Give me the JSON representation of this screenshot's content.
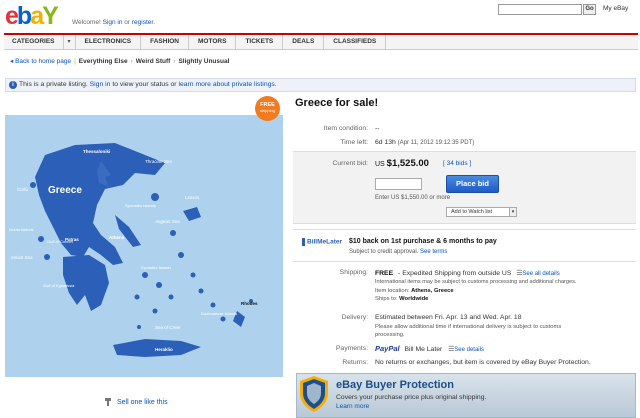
{
  "header": {
    "logo_letters": [
      "e",
      "b",
      "a",
      "Y"
    ],
    "logo_colors": [
      "#e53238",
      "#0064d2",
      "#f5af02",
      "#86b817"
    ],
    "welcome_prefix": "Welcome! ",
    "sign_in": "Sign in",
    "or": " or ",
    "register": "register",
    "register_suffix": ".",
    "search_value": "",
    "go_label": "Go",
    "my_ebay": "My eBay"
  },
  "nav": {
    "items": [
      "CATEGORIES",
      "ELECTRONICS",
      "FASHION",
      "MOTORS",
      "TICKETS",
      "DEALS",
      "CLASSIFIEDS"
    ],
    "caret": "▾"
  },
  "breadcrumb": {
    "back": "Back to home page",
    "path": [
      "Everything Else",
      "Weird Stuff",
      "Slightly Unusual"
    ],
    "sep": "|",
    "chev": "›"
  },
  "notice": {
    "icon": "i",
    "text_pre": "This is a private listing. ",
    "sign_in": "Sign in",
    "text_mid": " to view your status or ",
    "learn_more": "learn more about private listings",
    "text_post": "."
  },
  "image": {
    "badge_line1": "FREE",
    "badge_line2": "shipping",
    "map_labels": {
      "greece": "Greece",
      "thessaloniki": "Thessaloniki",
      "thracian": "Thracian Sea",
      "aegean": "Aegean Sea",
      "ionian": "Ionian Sea",
      "crete": "Sea of Crete",
      "athens": "Athens",
      "patras": "Patras",
      "corfu": "Corfu",
      "lesvos": "Lesvos",
      "rhodes": "Rhodes",
      "heraklio": "Heraklio",
      "sporades": "Sporades Islands",
      "cyclades": "Cyclades Islands",
      "dodecanese": "Dodecanese Islands",
      "ionian_islands": "Ionian Islands",
      "corinth": "Gulf of Corinth",
      "kyparissia": "Gulf of Kyparissia"
    },
    "sell_one": "Sell one like this"
  },
  "listing": {
    "title": "Greece for sale!",
    "condition_label": "Item condition:",
    "condition_value": "--",
    "time_label": "Time left:",
    "time_value": "6d 13h",
    "time_detail": "(Apr 11, 2012 19:12:35 PDT)",
    "bid_label": "Current bid:",
    "currency": "US ",
    "price": "$1,525.00",
    "bids_open": "[ ",
    "bids": "34 bids",
    "bids_close": " ]",
    "bid_input_value": "",
    "place_bid": "Place bid",
    "enter_min": "Enter US $1,550.00 or more",
    "watch": "Add to Watch list",
    "watch_caret": "▾"
  },
  "billmelater": {
    "logo": "BillMeLater",
    "offer": "$10 back on 1st purchase & 6 months to pay",
    "sub": "Subject to credit approval. ",
    "see_terms": "See terms"
  },
  "shipping": {
    "label": "Shipping:",
    "free": "FREE",
    "method": "Expedited Shipping from outside US",
    "see_all": "See all details",
    "note": "International items may be subject to customs processing and additional charges.",
    "location_label": "Item location: ",
    "location": "Athens, Greece",
    "ships_label": "Ships to: ",
    "ships_to": "Worldwide"
  },
  "delivery": {
    "label": "Delivery:",
    "estimate": "Estimated between Fri. Apr. 13 and Wed. Apr. 18",
    "note1": "Please allow additional time if international delivery is subject to customs",
    "note2": "processing."
  },
  "payments": {
    "label": "Payments:",
    "paypal": "PayPal",
    "bml": "Bill Me Later",
    "see_details": "See details"
  },
  "returns": {
    "label": "Returns:",
    "text": "No returns or exchanges, but item is covered by eBay Buyer Protection."
  },
  "protection": {
    "title": "eBay Buyer Protection",
    "sub": "Covers your purchase price plus original shipping.",
    "more": "Learn more"
  }
}
